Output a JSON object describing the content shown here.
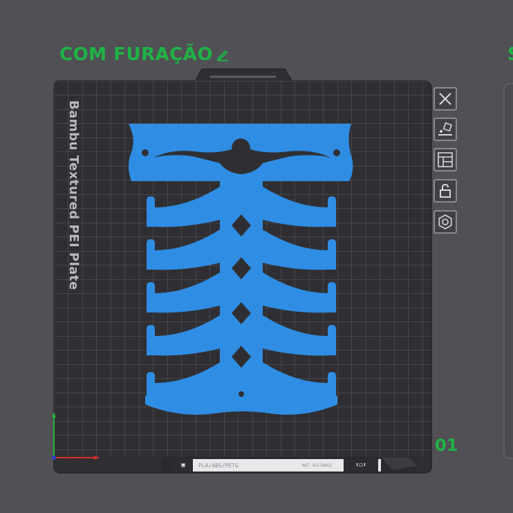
{
  "plate": {
    "name": "COM FURAÇÃO",
    "texture_label": "Bambu Textured PEI Plate",
    "number": "01",
    "next_name_fragment": "S"
  },
  "toolbar": {
    "buttons": [
      {
        "name": "close-plate-button",
        "icon": "close-icon"
      },
      {
        "name": "auto-orient-button",
        "icon": "auto-orient-icon"
      },
      {
        "name": "arrange-button",
        "icon": "arrange-icon"
      },
      {
        "name": "lock-plate-button",
        "icon": "lock-icon"
      },
      {
        "name": "plate-settings-button",
        "icon": "gear-icon"
      }
    ]
  },
  "filament_strip": {
    "types": "PLA/ABS/PETG",
    "note": "NOT SUITABLE"
  },
  "colors": {
    "accent": "#1fb345",
    "model": "#2f8de4",
    "plate": "#37373b",
    "grid": "#58585e",
    "axis_x": "#d9302a",
    "axis_y": "#27b33a"
  }
}
